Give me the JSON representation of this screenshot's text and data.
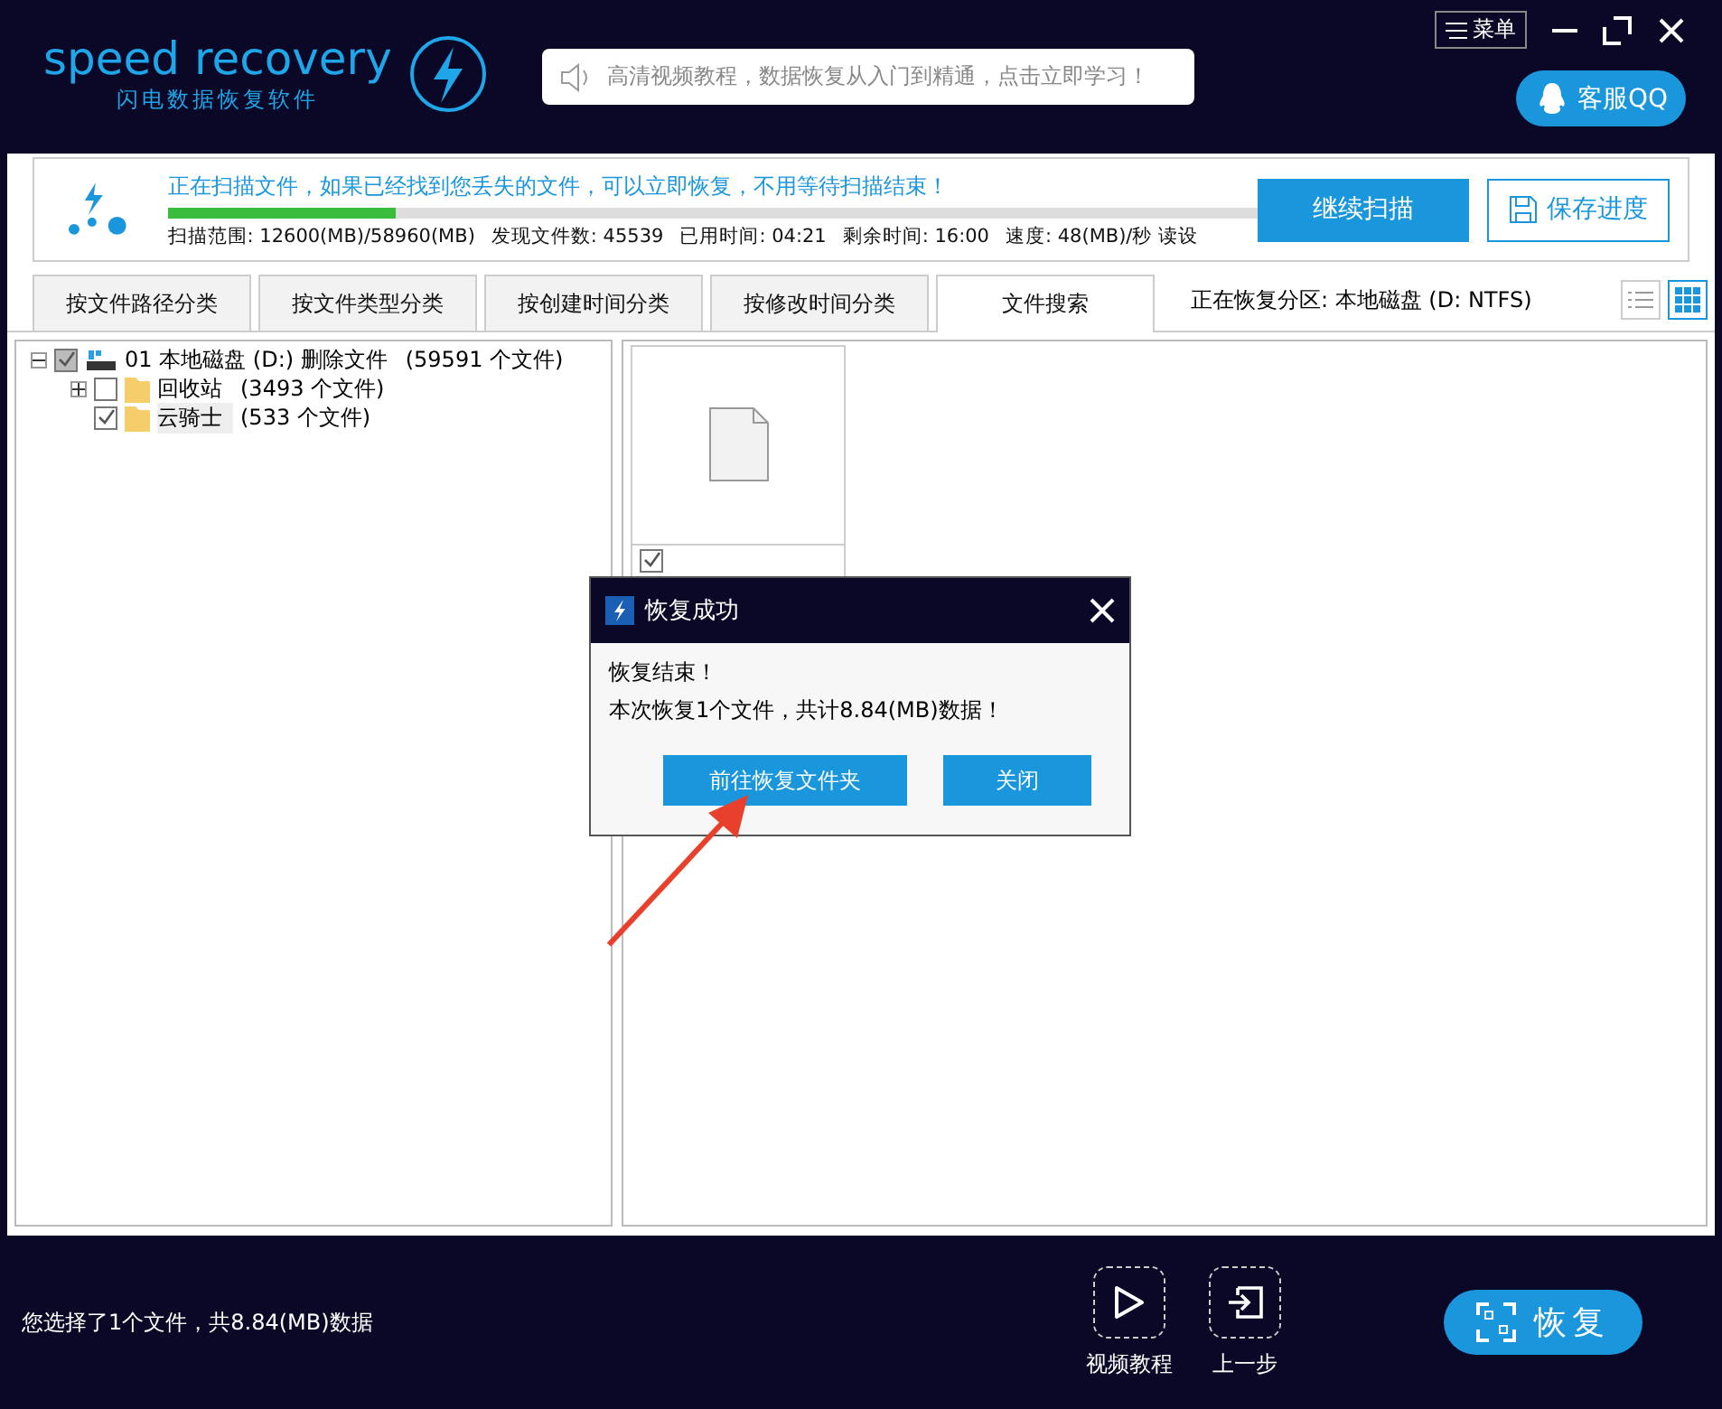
{
  "header": {
    "brand": "speed recovery",
    "tagline": "闪电数据恢复软件",
    "notice": "高清视频教程，数据恢复从入门到精通，点击立即学习！",
    "menu": "菜单",
    "support": "客服QQ"
  },
  "scan": {
    "message": "正在扫描文件，如果已经找到您丢失的文件，可以立即恢复，不用等待扫描结束！",
    "level": 0.21,
    "stats": [
      "扫描范围: 12600(MB)/58960(MB)",
      "发现文件数: 45539",
      "已用时间: 04:21",
      "剩余时间: 16:00",
      "速度: 48(MB)/秒  读设"
    ],
    "buttons": {
      "continue": "继续扫描",
      "save": "保存进度"
    }
  },
  "tabs": [
    {
      "label": "按文件路径分类",
      "selected": false
    },
    {
      "label": "按文件类型分类",
      "selected": false
    },
    {
      "label": "按创建时间分类",
      "selected": false
    },
    {
      "label": "按修改时间分类",
      "selected": false
    },
    {
      "label": "文件搜索",
      "selected": true
    }
  ],
  "partition": "正在恢复分区: 本地磁盘 (D: NTFS)",
  "view_modes": [
    {
      "kind": "list",
      "selected": false
    },
    {
      "kind": "grid",
      "selected": true
    }
  ],
  "tree": [
    {
      "label": "01 本地磁盘 (D:) 删除文件",
      "count": "(59591 个文件)",
      "kind": "drive",
      "checked": true,
      "expanded": true,
      "selected": false,
      "children": [
        {
          "label": "回收站",
          "count": "(3493 个文件)",
          "kind": "folder",
          "checked": false,
          "expanded": false,
          "selected": false
        },
        {
          "label": "云骑士",
          "count": "(533 个文件)",
          "kind": "folder",
          "checked": true,
          "selected": true
        }
      ]
    }
  ],
  "files": [
    {
      "checked": true
    }
  ],
  "dialog": {
    "title": "恢复成功",
    "lines": [
      "恢复结束！",
      "本次恢复1个文件，共计8.84(MB)数据！"
    ],
    "buttons": [
      "前往恢复文件夹",
      "关闭"
    ]
  },
  "footer": {
    "status": "您选择了1个文件，共8.84(MB)数据",
    "actions": [
      {
        "kind": "play",
        "label": "视频教程"
      },
      {
        "kind": "back",
        "label": "上一步"
      }
    ],
    "recover": "恢复"
  }
}
